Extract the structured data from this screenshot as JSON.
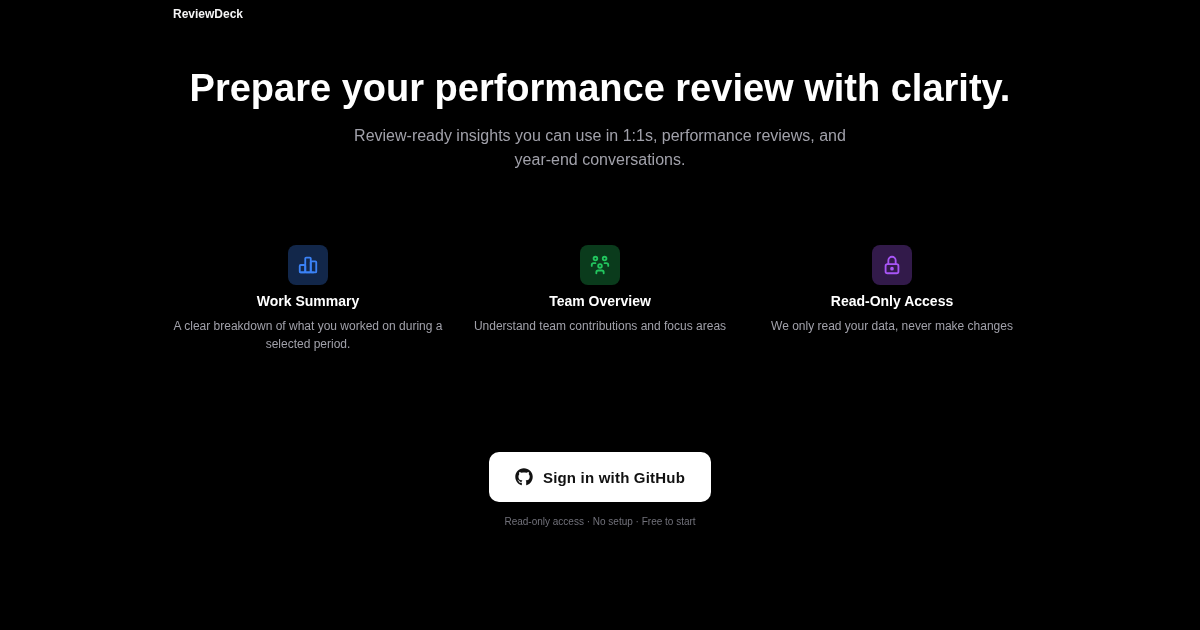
{
  "header": {
    "logo": "ReviewDeck"
  },
  "hero": {
    "title": "Prepare your performance review with clarity.",
    "subtitle": "Review-ready insights you can use in 1:1s, performance reviews, and year-end conversations."
  },
  "features": [
    {
      "kind": "chart",
      "color": "#3b82f6",
      "title": "Work Summary",
      "description": "A clear breakdown of what you worked on during a selected period."
    },
    {
      "kind": "team",
      "color": "#22c55e",
      "title": "Team Overview",
      "description": "Understand team contributions and focus areas"
    },
    {
      "kind": "lock",
      "color": "#a855f7",
      "title": "Read-Only Access",
      "description": "We only read your data, never make changes"
    }
  ],
  "cta": {
    "button": "Sign in with GitHub",
    "note": "Read-only access · No setup · Free to start"
  }
}
